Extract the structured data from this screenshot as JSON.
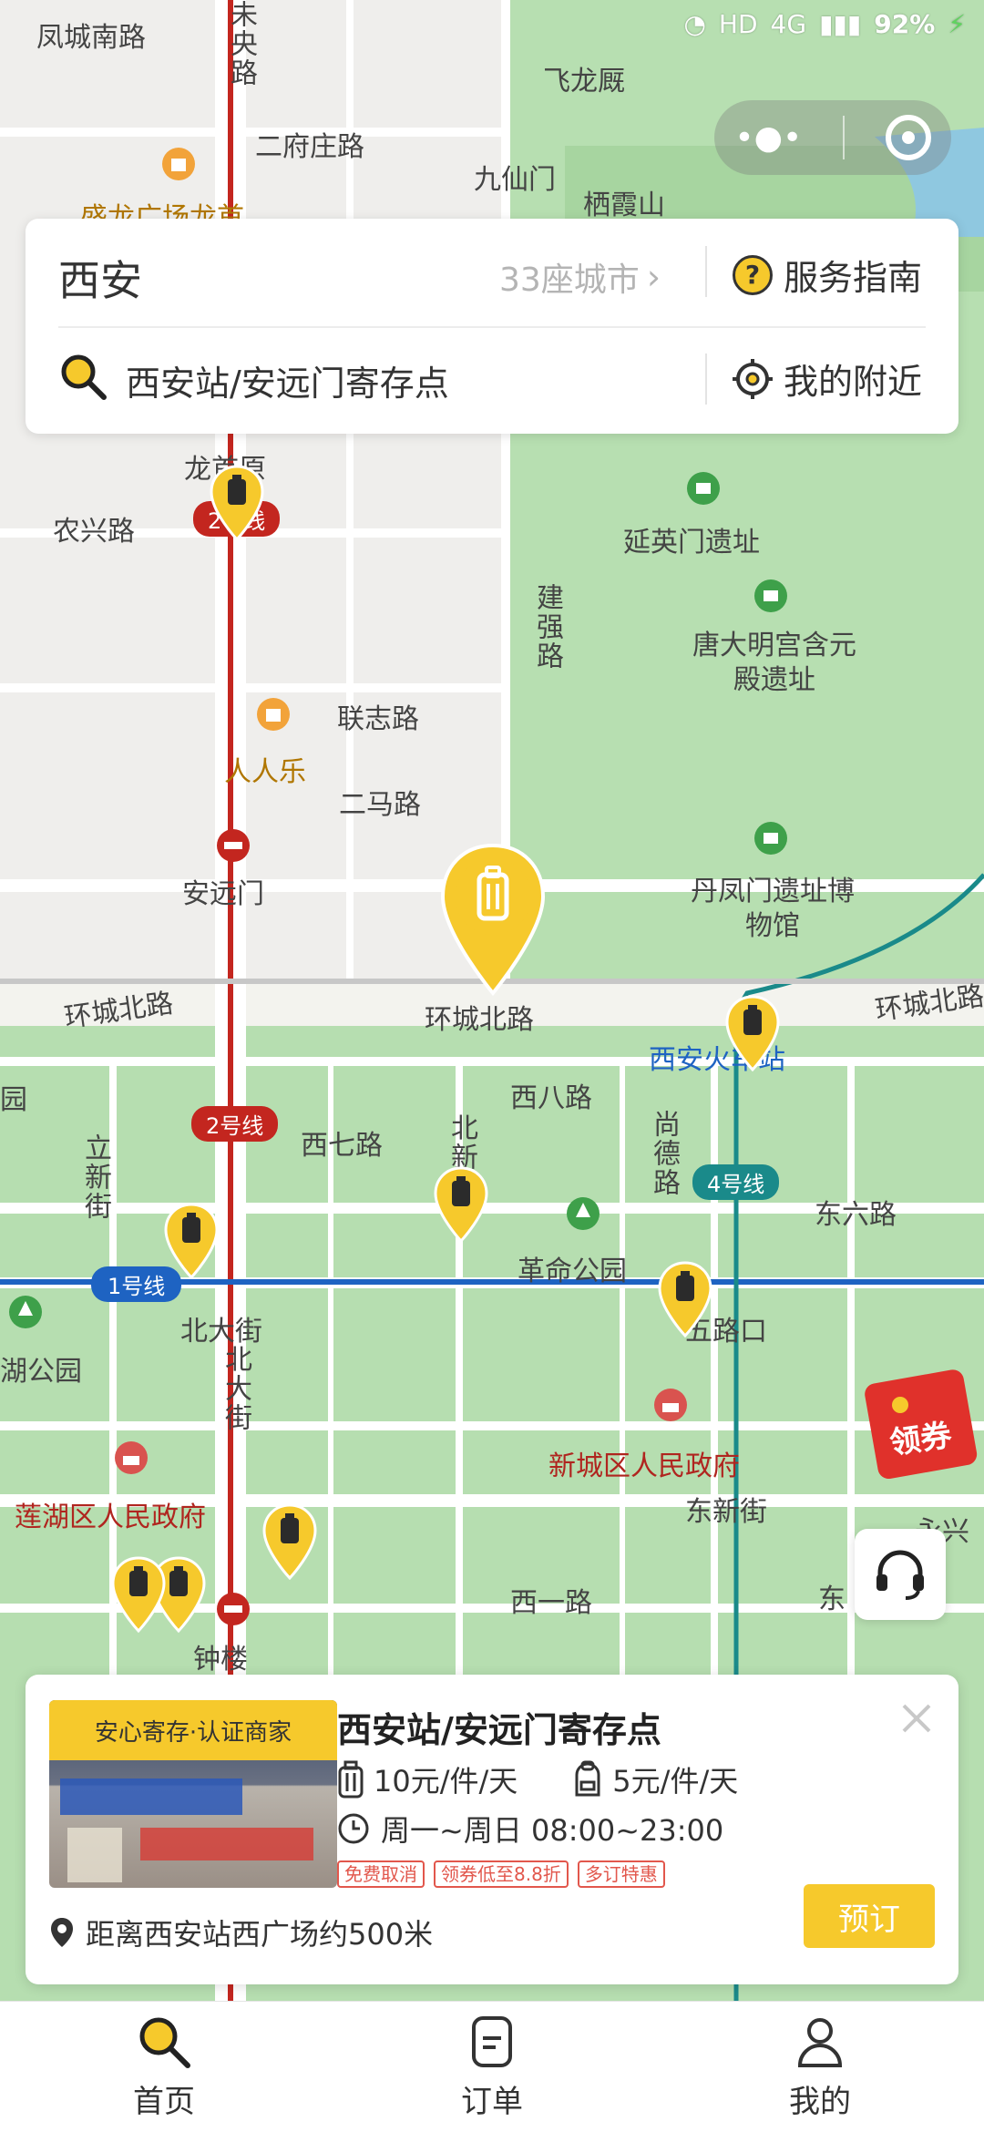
{
  "status_bar": {
    "battery": "92%",
    "network": "HD",
    "signal": "4G"
  },
  "header": {
    "city": "西安",
    "city_count": "33座城市",
    "service_guide": "服务指南"
  },
  "search": {
    "value": "西安站/安远门寄存点",
    "nearby": "我的附近"
  },
  "map": {
    "labels": {
      "l1": "凤城南路",
      "l2": "未央路",
      "l3": "二府庄路",
      "l4": "飞龙厩",
      "l5": "九仙门",
      "l6": "栖霞山",
      "l7": "盛龙广场龙首",
      "l8": "龙首原",
      "l9": "农兴路",
      "l10": "延英门遗址",
      "l11": "建强路",
      "l12": "唐大明宫含元殿遗址",
      "l13": "联志路",
      "l14": "人人乐",
      "l15": "二马路",
      "l16": "安远门",
      "l17": "丹凤门遗址博物馆",
      "l18": "环城北路",
      "l19": "环城北路",
      "l20": "环城北路",
      "l21": "西安火车站",
      "l22": "西八路",
      "l23": "西七路",
      "l24": "立新街",
      "l25": "北新街",
      "l26": "尚德路",
      "l27": "东六路",
      "l28": "革命公园",
      "l29": "北大街",
      "l30": "五路口",
      "l31": "北大街",
      "l32": "湖公园",
      "l33": "新城区人民政府",
      "l34": "东新街",
      "l35": "莲湖区人民政府",
      "l36": "西一路",
      "l37": "钟楼",
      "l38": "园",
      "l39": "永兴",
      "l40": "东"
    },
    "metro_lines": {
      "line1": "1号线",
      "line2": "2号线",
      "line4": "4号线",
      "line2b": "2号线"
    }
  },
  "floating": {
    "coupon": "领券"
  },
  "store": {
    "badge": "安心寄存·认证商家",
    "title": "西安站/安远门寄存点",
    "price_luggage": "10元/件/天",
    "price_bag": "5元/件/天",
    "hours": "周一~周日 08:00~23:00",
    "tags": [
      "免费取消",
      "领券低至8.8折",
      "多订特惠"
    ],
    "distance": "距离西安站西广场约500米",
    "book": "预订"
  },
  "tabs": [
    {
      "label": "首页"
    },
    {
      "label": "订单"
    },
    {
      "label": "我的"
    }
  ],
  "colors": {
    "accent": "#f6c92c",
    "park": "#b5ddb0",
    "road": "#ffffff",
    "metro1": "#1e63c2",
    "metro2": "#c3261f",
    "metro4": "#1a8a8a"
  }
}
